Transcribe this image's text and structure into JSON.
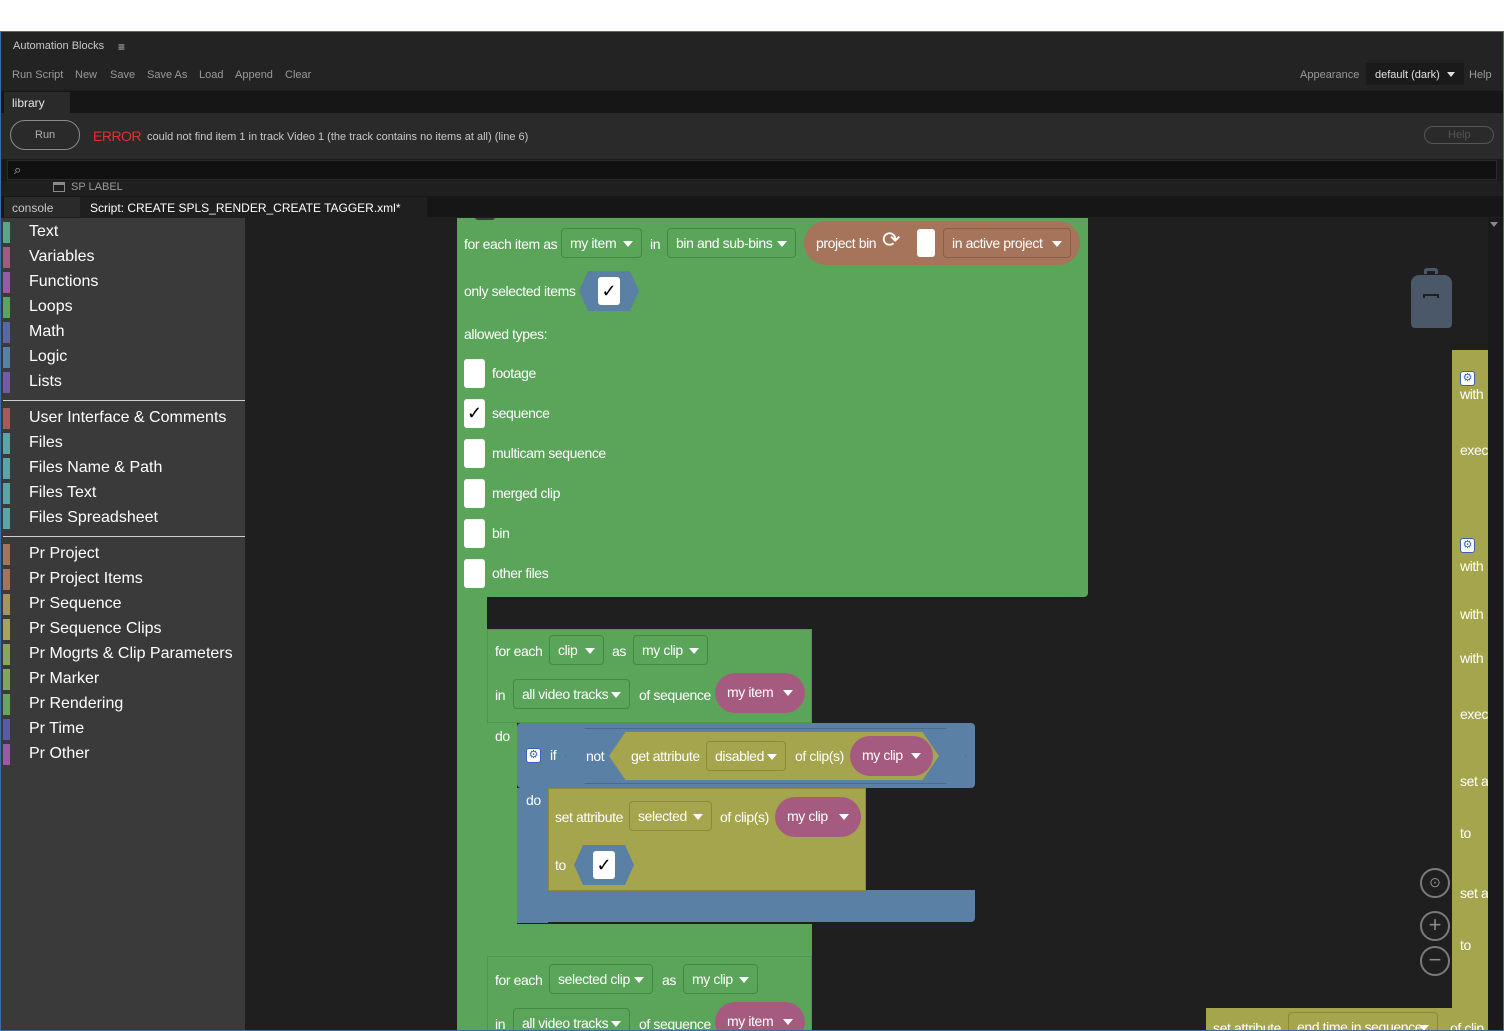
{
  "app": {
    "title": "Automation Blocks"
  },
  "menu": {
    "items": [
      "Run Script",
      "New",
      "Save",
      "Save As",
      "Load",
      "Append",
      "Clear"
    ],
    "appearance_label": "Appearance",
    "theme": "default (dark)",
    "help": "Help"
  },
  "tabs": {
    "library": "library"
  },
  "runbar": {
    "run": "Run",
    "error_label": "ERROR",
    "error_message": "could not find item 1 in track Video 1 (the track contains no items at all) (line 6)",
    "help": "Help"
  },
  "search": {
    "placeholder": ""
  },
  "sp_label": "SP LABEL",
  "editor_tabs": {
    "console": "console",
    "script": "Script: CREATE SPLS_RENDER_CREATE TAGGER.xml*"
  },
  "categories": [
    {
      "label": "Text",
      "color": "#5ba58c"
    },
    {
      "label": "Variables",
      "color": "#a55b80"
    },
    {
      "label": "Functions",
      "color": "#995ba5"
    },
    {
      "label": "Loops",
      "color": "#5ba55b"
    },
    {
      "label": "Math",
      "color": "#5b67a5"
    },
    {
      "label": "Logic",
      "color": "#5b80a5"
    },
    {
      "label": "Lists",
      "color": "#745ba5"
    },
    {
      "label": "User Interface & Comments",
      "color": "#a55b5b"
    },
    {
      "label": "Files",
      "color": "#5ba5a5"
    },
    {
      "label": "Files Name & Path",
      "color": "#5ba5a5"
    },
    {
      "label": "Files Text",
      "color": "#5ba5a5"
    },
    {
      "label": "Files Spreadsheet",
      "color": "#5ba5a5"
    },
    {
      "label": "Pr Project",
      "color": "#a5745b"
    },
    {
      "label": "Pr Project Items",
      "color": "#a5745b"
    },
    {
      "label": "Pr Sequence",
      "color": "#a5955b"
    },
    {
      "label": "Pr Sequence Clips",
      "color": "#a5a55b"
    },
    {
      "label": "Pr Mogrts & Clip Parameters",
      "color": "#8ca55b"
    },
    {
      "label": "Pr Marker",
      "color": "#80a55b"
    },
    {
      "label": "Pr Rendering",
      "color": "#6ba55b"
    },
    {
      "label": "Pr Time",
      "color": "#5b5ba5"
    },
    {
      "label": "Pr Other",
      "color": "#995ba5"
    }
  ],
  "blocks": {
    "foreach_item": "for each item as",
    "my_item": "my item",
    "in": "in",
    "bin_subbins": "bin and sub-bins",
    "project_bin": "project bin",
    "in_active_project": "in active project",
    "only_selected": "only selected items",
    "allowed_types": "allowed types:",
    "types": [
      {
        "label": "footage",
        "checked": false
      },
      {
        "label": "sequence",
        "checked": true
      },
      {
        "label": "multicam sequence",
        "checked": false
      },
      {
        "label": "merged clip",
        "checked": false
      },
      {
        "label": "bin",
        "checked": false
      },
      {
        "label": "other files",
        "checked": false
      }
    ],
    "do": "do",
    "for_each": "for each",
    "clip": "clip",
    "as": "as",
    "my_clip": "my clip",
    "all_video_tracks": "all video tracks",
    "of_sequence": "of sequence",
    "if": "if",
    "not": "not",
    "get_attribute": "get attribute",
    "disabled": "disabled",
    "of_clips": "of clip(s)",
    "set_attribute": "set attribute",
    "selected": "selected",
    "to": "to",
    "check": "✓",
    "selected_clip": "selected clip",
    "end_time_in_sequence": "end time in sequence",
    "of_clip_cut": "of clip",
    "right_panel": [
      "with",
      "exec",
      "with",
      "with",
      "with",
      "exec",
      "set a",
      "to",
      "set a",
      "to"
    ]
  }
}
